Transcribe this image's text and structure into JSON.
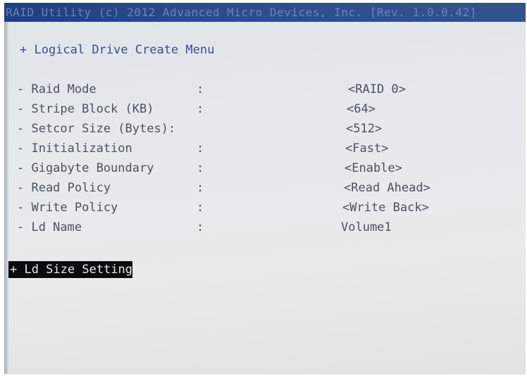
{
  "title_bar": "RAID Utility (c) 2012 Advanced Micro Devices, Inc. [Rev. 1.0.0.42]",
  "menu_title": "+ Logical Drive Create Menu",
  "fields": [
    {
      "label": "- Raid Mode",
      "colon": ":",
      "value": "<RAID 0>"
    },
    {
      "label": "- Stripe Block (KB)",
      "colon": ":",
      "value": "<64>"
    },
    {
      "label": "- Setcor Size  (Bytes):",
      "colon": "",
      "value": "<512>"
    },
    {
      "label": "- Initialization",
      "colon": ":",
      "value": "<Fast>"
    },
    {
      "label": "- Gigabyte Boundary",
      "colon": ":",
      "value": "<Enable>"
    },
    {
      "label": "- Read Policy",
      "colon": ":",
      "value": "<Read Ahead>"
    },
    {
      "label": "- Write Policy",
      "colon": ":",
      "value": "<Write Back>"
    },
    {
      "label": "- Ld Name",
      "colon": ":",
      "value": "Volume1"
    }
  ],
  "sub_menu": "+ Ld Size Setting",
  "colors": {
    "title_bar": "#2a4c8f",
    "menu_title": "#3a4f88",
    "text": "#4a5260",
    "highlight_bg": "#0c0c0e",
    "highlight_text": "#e9e9e9"
  }
}
